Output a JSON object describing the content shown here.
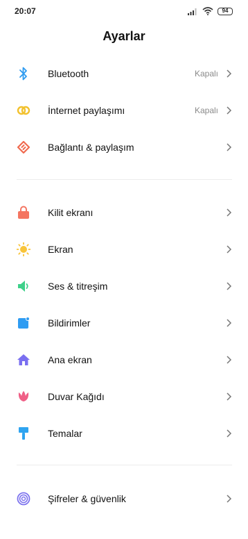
{
  "status_bar": {
    "time": "20:07",
    "battery": "94"
  },
  "title": "Ayarlar",
  "sections": [
    {
      "items": [
        {
          "label": "Bluetooth",
          "value": "Kapalı",
          "icon": "bluetooth-icon"
        },
        {
          "label": "İnternet paylaşımı",
          "value": "Kapalı",
          "icon": "hotspot-icon"
        },
        {
          "label": "Bağlantı & paylaşım",
          "icon": "connection-sharing-icon"
        }
      ]
    },
    {
      "items": [
        {
          "label": "Kilit ekranı",
          "icon": "lock-icon"
        },
        {
          "label": "Ekran",
          "icon": "sun-icon"
        },
        {
          "label": "Ses & titreşim",
          "icon": "speaker-icon"
        },
        {
          "label": "Bildirimler",
          "icon": "notification-icon"
        },
        {
          "label": "Ana ekran",
          "icon": "home-icon"
        },
        {
          "label": "Duvar Kağıdı",
          "icon": "tulip-icon"
        },
        {
          "label": "Temalar",
          "icon": "paintbrush-icon"
        }
      ]
    },
    {
      "items": [
        {
          "label": "Şifreler & güvenlik",
          "icon": "fingerprint-icon"
        }
      ]
    }
  ],
  "colors": {
    "bluetooth": "#2e9bf0",
    "hotspot": "#f2c12e",
    "connection": "#f06a4f",
    "lock": "#f47561",
    "sun": "#f8c43a",
    "speaker": "#3ed18a",
    "notification": "#2f9cf2",
    "home": "#7a6ff0",
    "tulip": "#ef5f86",
    "theme": "#2fa4f0",
    "fingerprint": "#7d73ee"
  }
}
